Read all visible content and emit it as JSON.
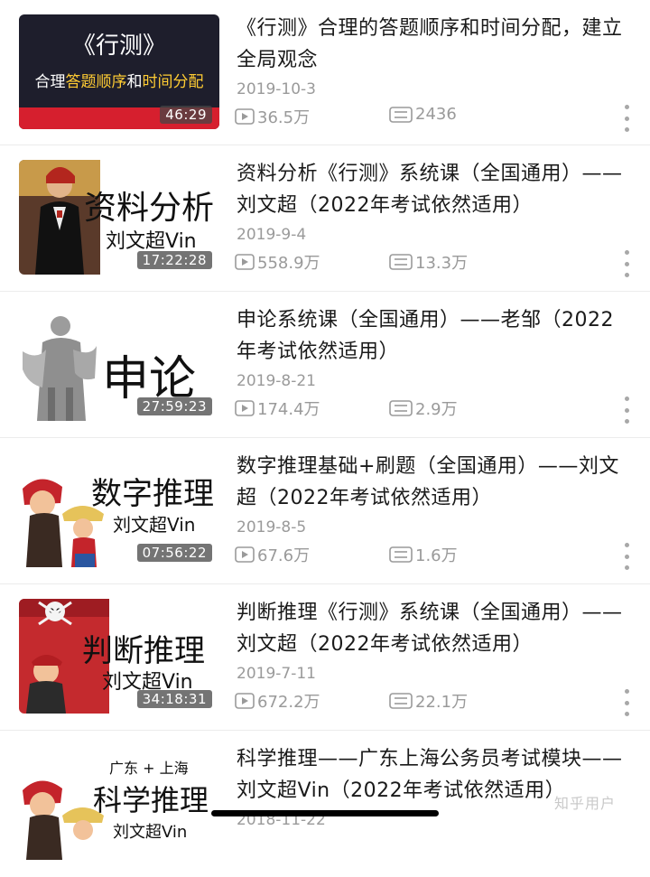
{
  "videos": [
    {
      "title": "《行测》合理的答题顺序和时间分配，建立全局观念",
      "date": "2019-10-3",
      "views": "36.5万",
      "comments": "2436",
      "duration": "46:29",
      "thumb_main": "《行测》",
      "thumb_sub_a": "合理",
      "thumb_sub_b": "答题顺序",
      "thumb_sub_c": "和",
      "thumb_sub_d": "时间分配"
    },
    {
      "title": "资料分析《行测》系统课（全国通用）——刘文超（2022年考试依然适用）",
      "date": "2019-9-4",
      "views": "558.9万",
      "comments": "13.3万",
      "duration": "17:22:28",
      "thumb_main": "资料分析",
      "thumb_handle": "刘文超Vin"
    },
    {
      "title": "申论系统课（全国通用）——老邹（2022年考试依然适用）",
      "date": "2019-8-21",
      "views": "174.4万",
      "comments": "2.9万",
      "duration": "27:59:23",
      "thumb_main": "申论"
    },
    {
      "title": "数字推理基础+刷题（全国通用）——刘文超（2022年考试依然适用）",
      "date": "2019-8-5",
      "views": "67.6万",
      "comments": "1.6万",
      "duration": "07:56:22",
      "thumb_main": "数字推理",
      "thumb_handle": "刘文超Vin"
    },
    {
      "title": "判断推理《行测》系统课（全国通用）——刘文超（2022年考试依然适用）",
      "date": "2019-7-11",
      "views": "672.2万",
      "comments": "22.1万",
      "duration": "34:18:31",
      "thumb_main": "判断推理",
      "thumb_handle": "刘文超Vin"
    },
    {
      "title": "科学推理——广东上海公务员考试模块——刘文超Vin（2022年考试依然适用）",
      "date": "2018-11-22",
      "thumb_top": "广东 + 上海",
      "thumb_main": "科学推理",
      "thumb_handle": "刘文超Vin"
    }
  ],
  "watermark": "知乎用户",
  "colors": {
    "accent_red": "#d61f2e",
    "accent_yellow": "#ffcc33",
    "meta_gray": "#9a9a9a"
  },
  "icons": {
    "views": "play-icon",
    "comments": "comment-icon",
    "menu": "more-vertical-icon"
  }
}
